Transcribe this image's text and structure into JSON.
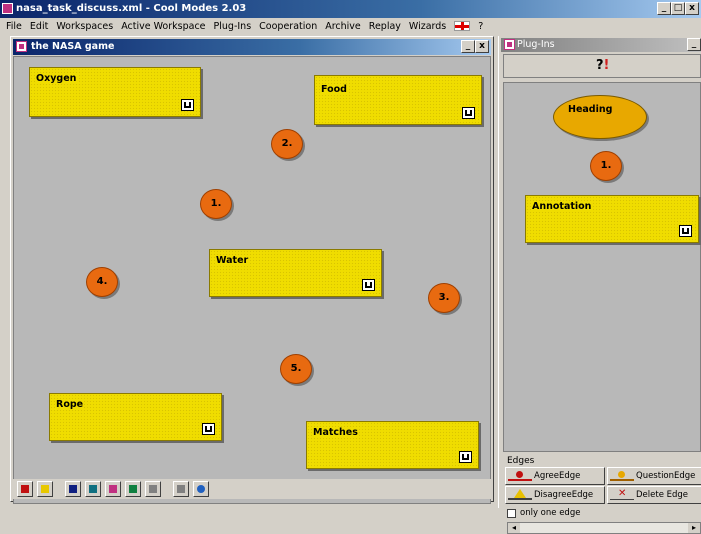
{
  "app": {
    "title": "nasa_task_discuss.xml - Cool Modes 2.03",
    "min_label": "_",
    "max_label": "□",
    "close_label": "x"
  },
  "menubar": {
    "items": [
      "File",
      "Edit",
      "Workspaces",
      "Active Workspace",
      "Plug-Ins",
      "Cooperation",
      "Archive",
      "Replay",
      "Wizards"
    ],
    "help_label": "?"
  },
  "game_window": {
    "title": "the NASA game",
    "min_label": "_",
    "close_label": "x",
    "cards": {
      "oxygen": "Oxygen",
      "food": "Food",
      "water": "Water",
      "rope": "Rope",
      "matches": "Matches"
    },
    "markers": {
      "m1": "1.",
      "m2": "2.",
      "m3": "3.",
      "m4": "4.",
      "m5": "5."
    }
  },
  "plugin_window": {
    "title": "Plug-Ins",
    "min_label": "_",
    "tab_icon_left": "?",
    "tab_icon_right": "!",
    "palette": {
      "heading": "Heading",
      "marker": "1.",
      "annotation": "Annotation"
    },
    "edges": {
      "title": "Edges",
      "agree": "AgreeEdge",
      "question": "QuestionEdge",
      "disagree": "DisagreeEdge",
      "delete": "Delete Edge",
      "only_one": "only one edge"
    }
  },
  "colors": {
    "card": "#f0dd00",
    "marker": "#e86a10",
    "heading": "#e8a800",
    "canvas": "#b8b8b8",
    "titlebar": "#0a246a"
  }
}
